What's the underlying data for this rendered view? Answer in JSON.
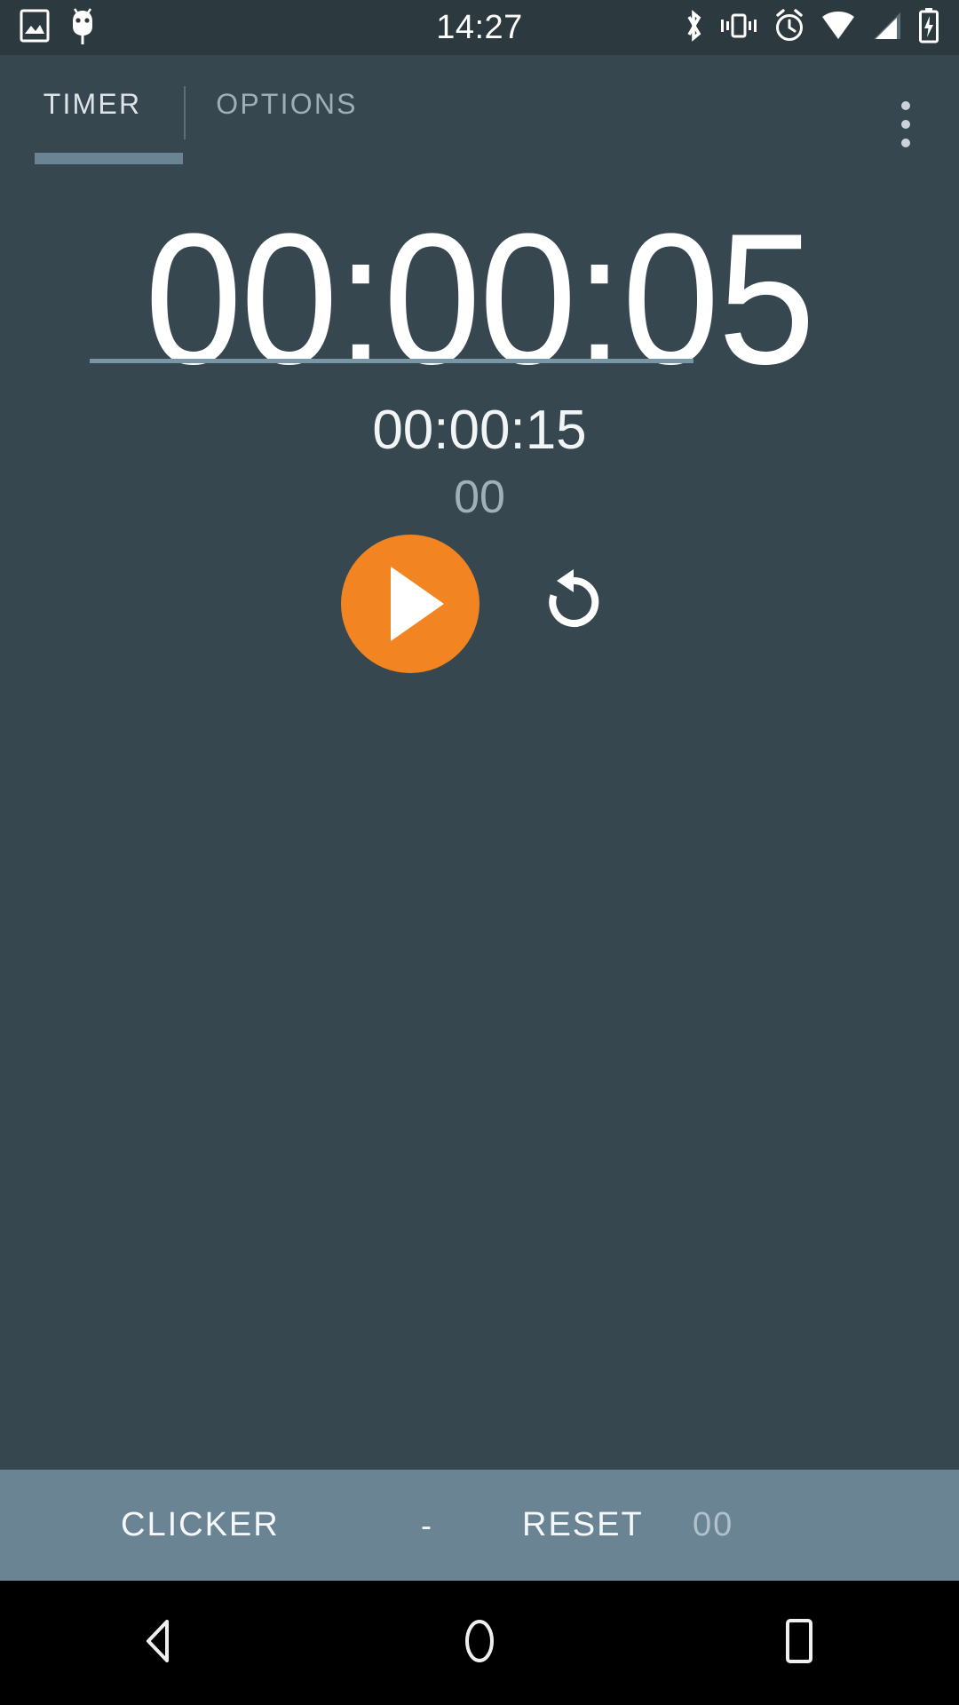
{
  "status_bar": {
    "time": "14:27",
    "left_icons": [
      {
        "name": "screenshot-icon",
        "glyph": "image"
      },
      {
        "name": "android-debug-icon",
        "glyph": "bug"
      }
    ],
    "right_icons": [
      {
        "name": "bluetooth-icon",
        "glyph": "bluetooth"
      },
      {
        "name": "vibrate-icon",
        "glyph": "vibrate"
      },
      {
        "name": "alarm-icon",
        "glyph": "alarm"
      },
      {
        "name": "wifi-icon",
        "glyph": "wifi"
      },
      {
        "name": "cellular-signal-icon",
        "glyph": "signal"
      },
      {
        "name": "battery-charging-icon",
        "glyph": "battery-charging"
      }
    ],
    "background": "#2C393F"
  },
  "tabs": {
    "items": [
      {
        "label": "TIMER",
        "active": true
      },
      {
        "label": "OPTIONS",
        "active": false
      }
    ],
    "indicator_color": "#6A8494",
    "overflow_label": "More options"
  },
  "timer": {
    "primary_display": "00:00:05",
    "secondary_display": "00:00:15",
    "lap_counter": "00",
    "underline_color": "#7896A6"
  },
  "controls": {
    "play_button": {
      "name": "play",
      "color": "#F28521"
    },
    "reset_button": {
      "name": "restore",
      "color": "#FFFFFF"
    }
  },
  "bottom_bar": {
    "background": "#6A8494",
    "clicker_label": "CLICKER",
    "separator": "-",
    "reset_label": "RESET",
    "count": "00"
  },
  "nav_bar": {
    "background": "#000000",
    "buttons": [
      {
        "name": "back",
        "glyph": "triangle-left"
      },
      {
        "name": "home",
        "glyph": "circle"
      },
      {
        "name": "recents",
        "glyph": "square"
      }
    ]
  },
  "theme": {
    "app_background": "#37474F",
    "accent": "#F28521",
    "text_primary": "#FFFFFF",
    "text_muted": "#9FB0BA"
  }
}
